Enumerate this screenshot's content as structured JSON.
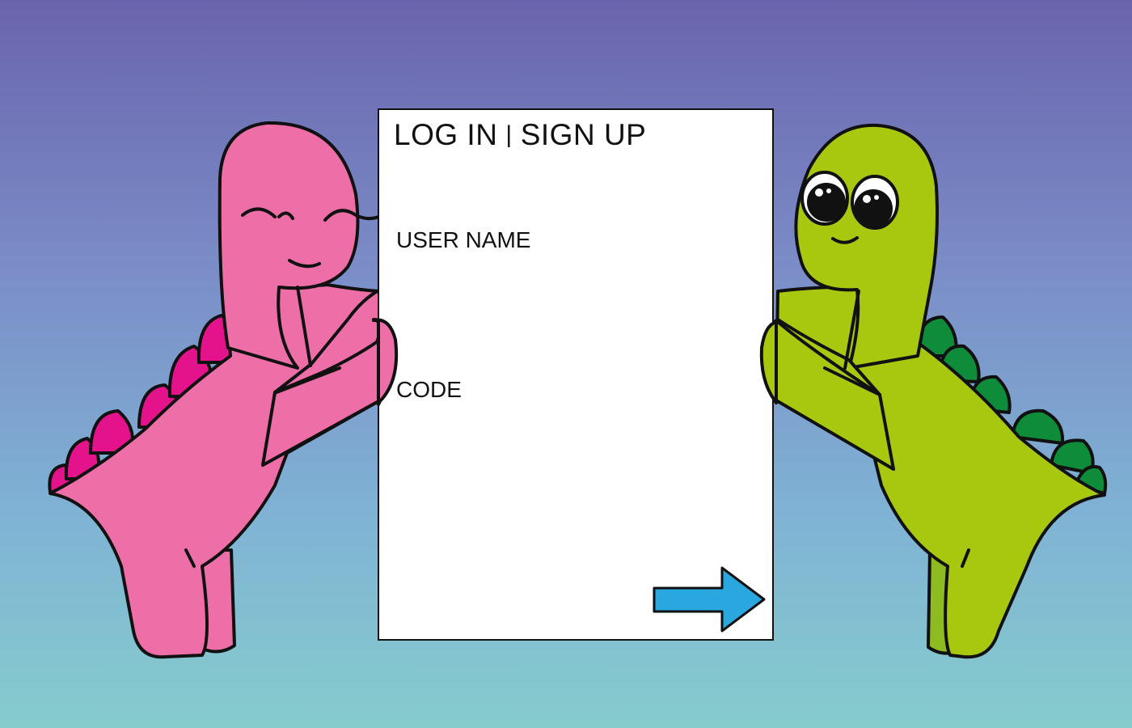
{
  "login_card": {
    "login_tab": "LOG IN",
    "separator": "|",
    "signup_tab": "SIGN UP",
    "username_label": "USER NAME",
    "username_value": "",
    "code_label": "CODE",
    "code_value": "",
    "next_button_icon": "right-arrow-icon"
  },
  "colors": {
    "background_top": "#6a64ad",
    "background_bottom": "#86cccd",
    "pink_dino": "#ee6ea8",
    "pink_spikes": "#e5138b",
    "green_dino": "#a8c70f",
    "green_spikes": "#0f8c3a",
    "arrow": "#29a8e0"
  }
}
